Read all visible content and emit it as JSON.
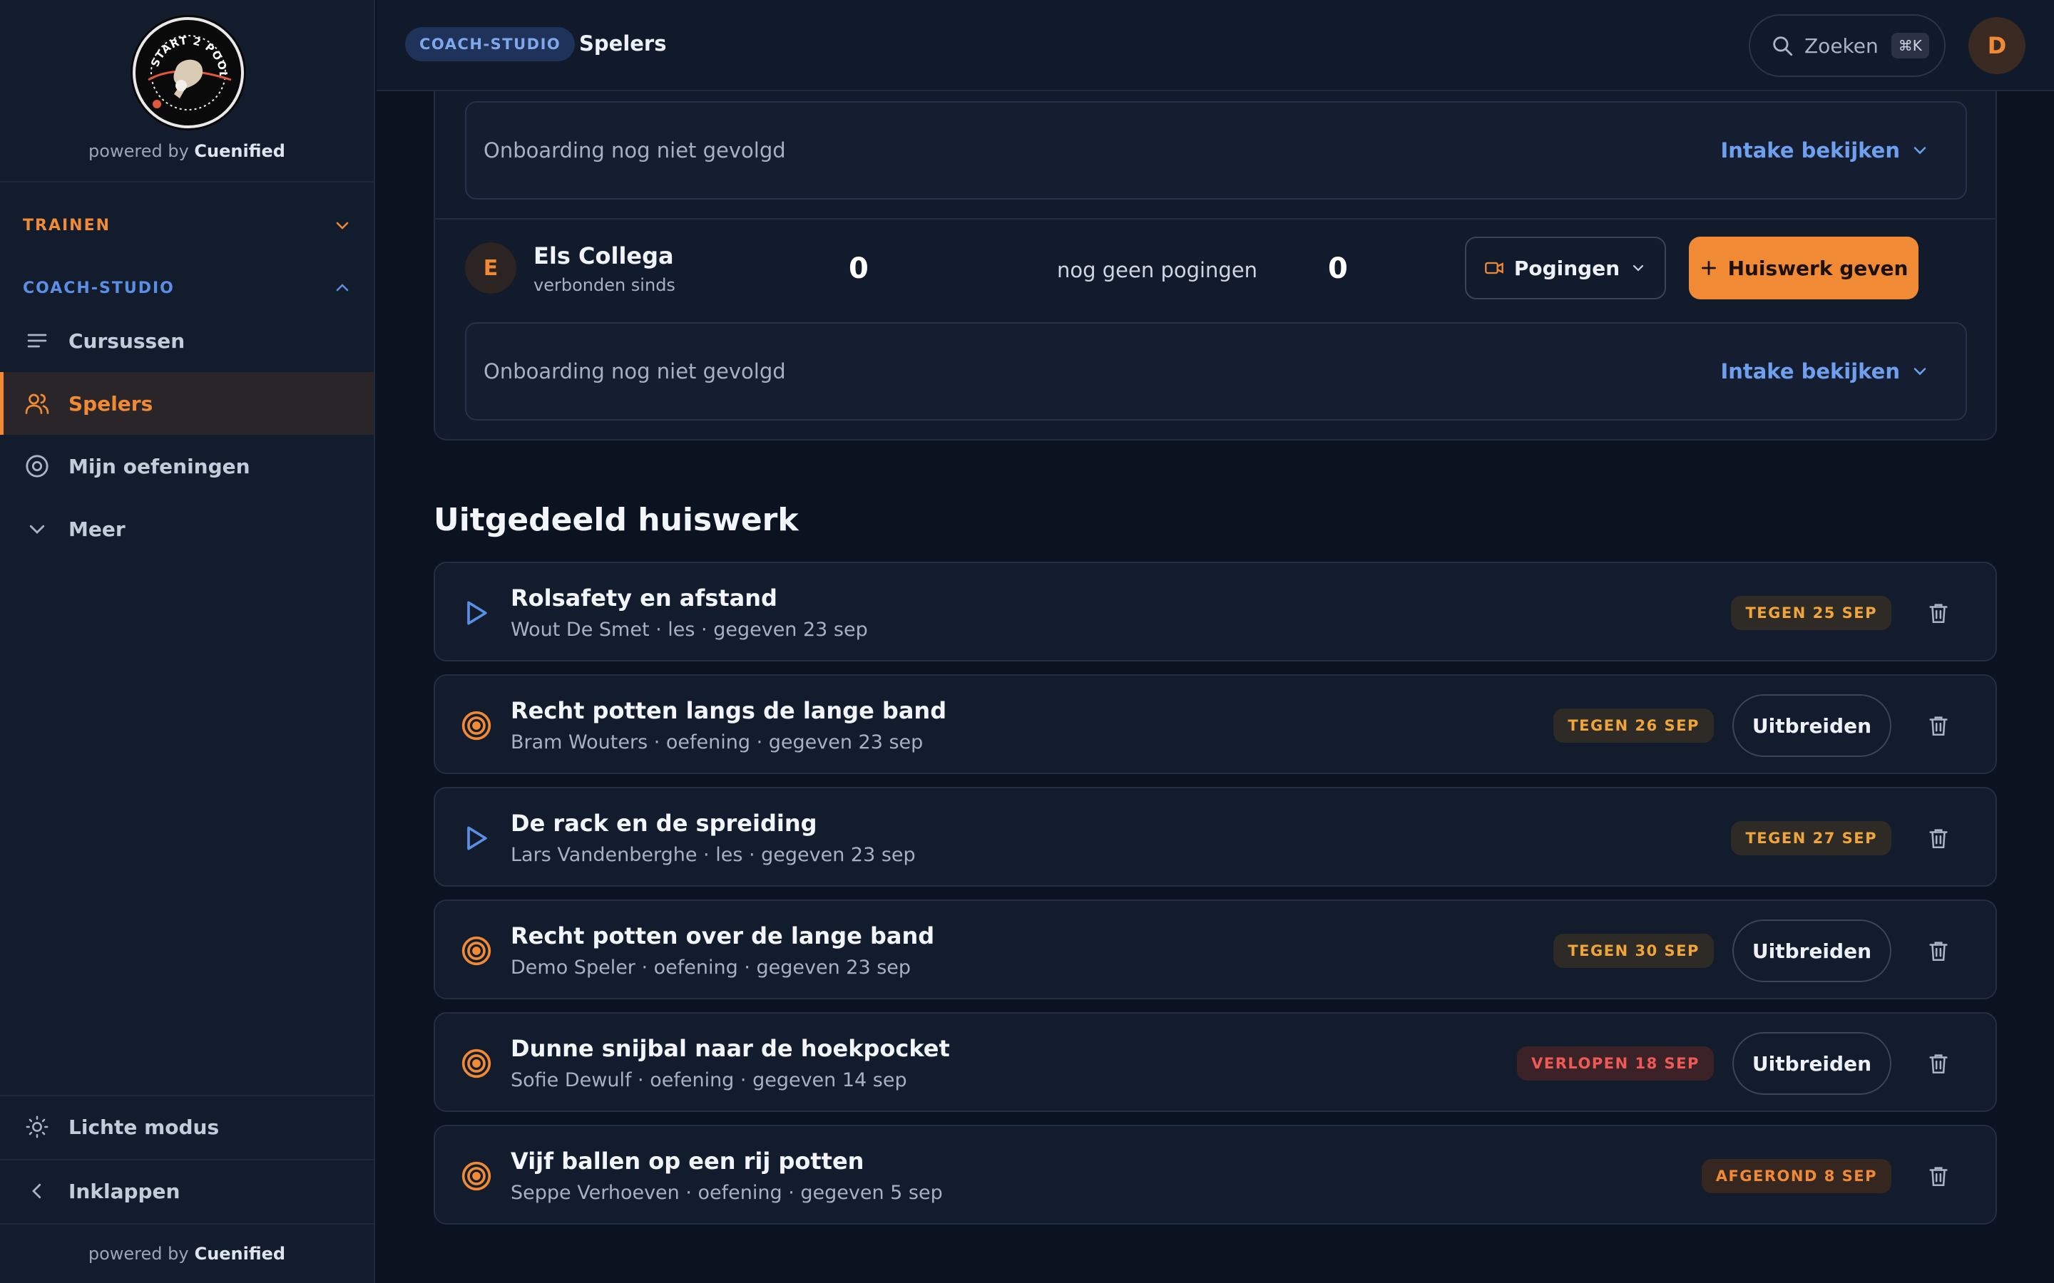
{
  "brand": {
    "logo_text": "START 2 POOL",
    "powered_prefix": "powered by",
    "powered_name": "Cuenified"
  },
  "sidebar": {
    "section_trainen": "TRAINEN",
    "section_coach": "COACH-STUDIO",
    "items": [
      {
        "label": "Cursussen",
        "icon": "list-icon"
      },
      {
        "label": "Spelers",
        "icon": "users-icon",
        "active": true
      },
      {
        "label": "Mijn oefeningen",
        "icon": "target-icon"
      },
      {
        "label": "Meer",
        "icon": "chevron-down-icon"
      }
    ],
    "light_mode": "Lichte modus",
    "collapse": "Inklappen"
  },
  "topbar": {
    "badge": "COACH-STUDIO",
    "crumb": "Spelers",
    "search_label": "Zoeken",
    "search_kbd": "⌘K",
    "avatar_initial": "D"
  },
  "players": {
    "intake_text": "Onboarding nog niet gevolgd",
    "intake_link": "Intake bekijken",
    "player": {
      "initial": "E",
      "name": "Els Collega",
      "sub": "verbonden sinds",
      "count1": "0",
      "attempts_text": "nog geen pogingen",
      "count2": "0",
      "attempts_button": "Pogingen",
      "homework_button": "Huiswerk geven"
    }
  },
  "homework": {
    "title": "Uitgedeeld huiswerk",
    "extend_label": "Uitbreiden",
    "items": [
      {
        "name": "Rolsafety en afstand",
        "meta": "Wout De Smet · les · gegeven 23 sep",
        "kind": "les",
        "status": "TEGEN 25 SEP",
        "status_type": "due",
        "extend": false
      },
      {
        "name": "Recht potten langs de lange band",
        "meta": "Bram Wouters · oefening · gegeven 23 sep",
        "kind": "oefening",
        "status": "TEGEN 26 SEP",
        "status_type": "due",
        "extend": true
      },
      {
        "name": "De rack en de spreiding",
        "meta": "Lars Vandenberghe · les · gegeven 23 sep",
        "kind": "les",
        "status": "TEGEN 27 SEP",
        "status_type": "due",
        "extend": false
      },
      {
        "name": "Recht potten over de lange band",
        "meta": "Demo Speler · oefening · gegeven 23 sep",
        "kind": "oefening",
        "status": "TEGEN 30 SEP",
        "status_type": "due",
        "extend": true
      },
      {
        "name": "Dunne snijbal naar de hoekpocket",
        "meta": "Sofie Dewulf · oefening · gegeven 14 sep",
        "kind": "oefening",
        "status": "VERLOPEN 18 SEP",
        "status_type": "late",
        "extend": true
      },
      {
        "name": "Vijf ballen op een rij potten",
        "meta": "Seppe Verhoeven · oefening · gegeven 5 sep",
        "kind": "oefening",
        "status": "AFGEROND 8 SEP",
        "status_type": "done",
        "extend": false
      }
    ]
  },
  "colors": {
    "accent": "#f08a35",
    "link": "#6f9fef",
    "danger": "#ef5a56",
    "background": "#0b1220"
  }
}
